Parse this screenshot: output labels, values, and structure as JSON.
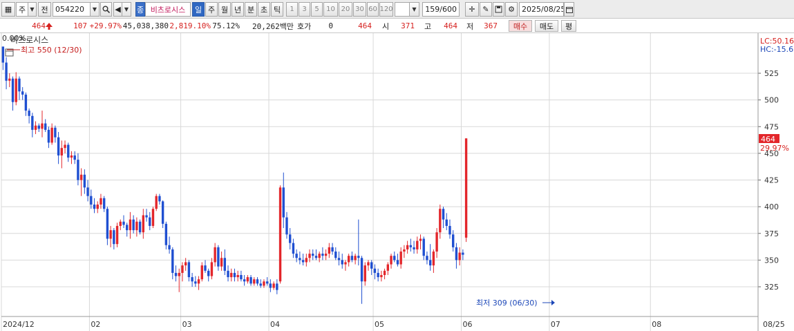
{
  "toolbar": {
    "market": "주",
    "prev_label": "전",
    "code": "054220",
    "stock_name": "비츠로시스",
    "badge": "종",
    "periods": [
      "일",
      "주",
      "월",
      "년",
      "분",
      "초",
      "틱"
    ],
    "active_period": "일",
    "intervals": [
      "1",
      "3",
      "5",
      "10",
      "20",
      "30",
      "60",
      "120"
    ],
    "count": "159/600",
    "date": "2025/08/25"
  },
  "quote": {
    "price": "464",
    "change": "107",
    "change_pct": "+29.97%",
    "volume": "45,038,380",
    "volume_ratio": "2,819.10%",
    "turnover": "75.12%",
    "amount": "20,262백만",
    "bid_label": "호가",
    "bid_value": "0",
    "bid_price": "464",
    "open_label": "시",
    "open": "371",
    "high_label": "고",
    "high": "464",
    "low_label": "저",
    "low": "367",
    "buy_label": "매수",
    "sell_label": "매도",
    "eval_label": "평"
  },
  "chart_labels": {
    "pct": "0.00%",
    "stock_name": "비츠로시스",
    "high_note": "최고 550 (12/30)",
    "low_note": "최저 309 (06/30)",
    "lc": "LC:50.16",
    "hc": "HC:-15.6",
    "last_price": "464",
    "last_pct": "29.97%"
  },
  "colors": {
    "up": "#e3262b",
    "down": "#1f4fd1",
    "grid": "#d8d8d8",
    "axis_bg": "#ffffff"
  },
  "chart_data": {
    "type": "candlestick",
    "ylim": [
      300,
      560
    ],
    "y_ticks": [
      325,
      350,
      375,
      400,
      425,
      450,
      475,
      500,
      525
    ],
    "x_ticks": [
      "2024/12",
      "02",
      "03",
      "04",
      "05",
      "06",
      "07",
      "08",
      "08/25"
    ],
    "x_tick_index": [
      0,
      27,
      55,
      82,
      114,
      141,
      168,
      199,
      230
    ],
    "n_slots": 232,
    "candles": [
      [
        550,
        545,
        528,
        535
      ],
      [
        535,
        540,
        510,
        518
      ],
      [
        518,
        525,
        512,
        520
      ],
      [
        520,
        522,
        490,
        498
      ],
      [
        498,
        526,
        495,
        520
      ],
      [
        520,
        522,
        500,
        508
      ],
      [
        508,
        512,
        500,
        505
      ],
      [
        505,
        507,
        485,
        490
      ],
      [
        490,
        492,
        478,
        485
      ],
      [
        485,
        488,
        465,
        472
      ],
      [
        472,
        480,
        468,
        476
      ],
      [
        476,
        478,
        470,
        473
      ],
      [
        473,
        490,
        465,
        478
      ],
      [
        478,
        482,
        470,
        472
      ],
      [
        472,
        475,
        455,
        460
      ],
      [
        460,
        478,
        458,
        474
      ],
      [
        474,
        476,
        460,
        465
      ],
      [
        465,
        470,
        440,
        448
      ],
      [
        448,
        462,
        436,
        455
      ],
      [
        455,
        462,
        450,
        458
      ],
      [
        458,
        460,
        442,
        446
      ],
      [
        446,
        452,
        440,
        448
      ],
      [
        448,
        452,
        440,
        444
      ],
      [
        444,
        450,
        420,
        425
      ],
      [
        425,
        436,
        410,
        430
      ],
      [
        430,
        435,
        412,
        418
      ],
      [
        418,
        425,
        405,
        410
      ],
      [
        410,
        416,
        398,
        402
      ],
      [
        402,
        408,
        394,
        398
      ],
      [
        398,
        405,
        394,
        402
      ],
      [
        402,
        412,
        398,
        408
      ],
      [
        408,
        410,
        395,
        398
      ],
      [
        398,
        400,
        364,
        370
      ],
      [
        370,
        382,
        362,
        378
      ],
      [
        378,
        380,
        360,
        365
      ],
      [
        365,
        385,
        362,
        382
      ],
      [
        382,
        388,
        378,
        386
      ],
      [
        386,
        392,
        380,
        383
      ],
      [
        383,
        385,
        372,
        378
      ],
      [
        378,
        395,
        370,
        388
      ],
      [
        388,
        392,
        375,
        378
      ],
      [
        378,
        390,
        372,
        386
      ],
      [
        386,
        388,
        374,
        376
      ],
      [
        376,
        398,
        370,
        392
      ],
      [
        392,
        398,
        386,
        390
      ],
      [
        390,
        395,
        378,
        382
      ],
      [
        382,
        400,
        380,
        398
      ],
      [
        398,
        412,
        396,
        410
      ],
      [
        410,
        412,
        402,
        405
      ],
      [
        405,
        406,
        380,
        384
      ],
      [
        384,
        386,
        360,
        364
      ],
      [
        364,
        372,
        356,
        360
      ],
      [
        360,
        362,
        332,
        338
      ],
      [
        338,
        345,
        330,
        335
      ],
      [
        335,
        342,
        320,
        338
      ],
      [
        338,
        348,
        330,
        345
      ],
      [
        345,
        352,
        340,
        348
      ],
      [
        348,
        350,
        330,
        334
      ],
      [
        334,
        338,
        325,
        330
      ],
      [
        330,
        335,
        325,
        328
      ],
      [
        328,
        335,
        322,
        332
      ],
      [
        332,
        348,
        330,
        345
      ],
      [
        345,
        350,
        338,
        340
      ],
      [
        340,
        342,
        330,
        335
      ],
      [
        335,
        352,
        332,
        348
      ],
      [
        348,
        366,
        344,
        362
      ],
      [
        362,
        364,
        340,
        344
      ],
      [
        344,
        358,
        340,
        352
      ],
      [
        352,
        360,
        336,
        340
      ],
      [
        340,
        345,
        330,
        334
      ],
      [
        334,
        342,
        330,
        338
      ],
      [
        338,
        342,
        330,
        334
      ],
      [
        334,
        340,
        330,
        336
      ],
      [
        336,
        340,
        330,
        332
      ],
      [
        332,
        336,
        326,
        330
      ],
      [
        330,
        336,
        328,
        334
      ],
      [
        334,
        336,
        326,
        328
      ],
      [
        328,
        334,
        326,
        332
      ],
      [
        332,
        334,
        326,
        328
      ],
      [
        328,
        332,
        324,
        326
      ],
      [
        326,
        332,
        324,
        330
      ],
      [
        330,
        334,
        326,
        328
      ],
      [
        328,
        332,
        320,
        324
      ],
      [
        324,
        330,
        322,
        328
      ],
      [
        328,
        332,
        318,
        322
      ],
      [
        330,
        420,
        328,
        418
      ],
      [
        418,
        432,
        380,
        390
      ],
      [
        390,
        395,
        370,
        374
      ],
      [
        374,
        380,
        360,
        366
      ],
      [
        366,
        370,
        352,
        356
      ],
      [
        356,
        360,
        348,
        352
      ],
      [
        352,
        358,
        346,
        350
      ],
      [
        350,
        356,
        345,
        348
      ],
      [
        348,
        356,
        344,
        352
      ],
      [
        352,
        360,
        348,
        356
      ],
      [
        356,
        360,
        350,
        354
      ],
      [
        354,
        360,
        350,
        352
      ],
      [
        352,
        358,
        348,
        356
      ],
      [
        356,
        362,
        350,
        354
      ],
      [
        354,
        360,
        350,
        356
      ],
      [
        356,
        366,
        352,
        362
      ],
      [
        362,
        366,
        355,
        358
      ],
      [
        358,
        362,
        350,
        352
      ],
      [
        352,
        358,
        345,
        350
      ],
      [
        350,
        356,
        342,
        346
      ],
      [
        346,
        350,
        340,
        348
      ],
      [
        348,
        356,
        344,
        354
      ],
      [
        354,
        358,
        348,
        350
      ],
      [
        350,
        356,
        346,
        354
      ],
      [
        354,
        388,
        345,
        352
      ],
      [
        352,
        354,
        309,
        330
      ],
      [
        330,
        348,
        326,
        345
      ],
      [
        345,
        350,
        340,
        348
      ],
      [
        348,
        350,
        336,
        342
      ],
      [
        342,
        346,
        332,
        338
      ],
      [
        338,
        342,
        330,
        334
      ],
      [
        334,
        340,
        330,
        336
      ],
      [
        336,
        342,
        332,
        340
      ],
      [
        340,
        348,
        336,
        346
      ],
      [
        346,
        356,
        342,
        354
      ],
      [
        354,
        358,
        348,
        350
      ],
      [
        350,
        356,
        344,
        346
      ],
      [
        346,
        362,
        342,
        358
      ],
      [
        358,
        364,
        352,
        360
      ],
      [
        360,
        368,
        356,
        364
      ],
      [
        364,
        370,
        358,
        362
      ],
      [
        362,
        368,
        356,
        360
      ],
      [
        360,
        372,
        356,
        368
      ],
      [
        368,
        374,
        360,
        370
      ],
      [
        370,
        372,
        350,
        354
      ],
      [
        354,
        358,
        346,
        350
      ],
      [
        350,
        365,
        340,
        345
      ],
      [
        345,
        360,
        338,
        358
      ],
      [
        358,
        380,
        352,
        376
      ],
      [
        376,
        402,
        370,
        398
      ],
      [
        398,
        400,
        380,
        388
      ],
      [
        388,
        394,
        378,
        382
      ],
      [
        382,
        388,
        370,
        374
      ],
      [
        374,
        378,
        358,
        362
      ],
      [
        362,
        366,
        342,
        350
      ],
      [
        350,
        362,
        345,
        357
      ],
      [
        357,
        360,
        350,
        355
      ],
      [
        371,
        464,
        367,
        464
      ]
    ]
  }
}
